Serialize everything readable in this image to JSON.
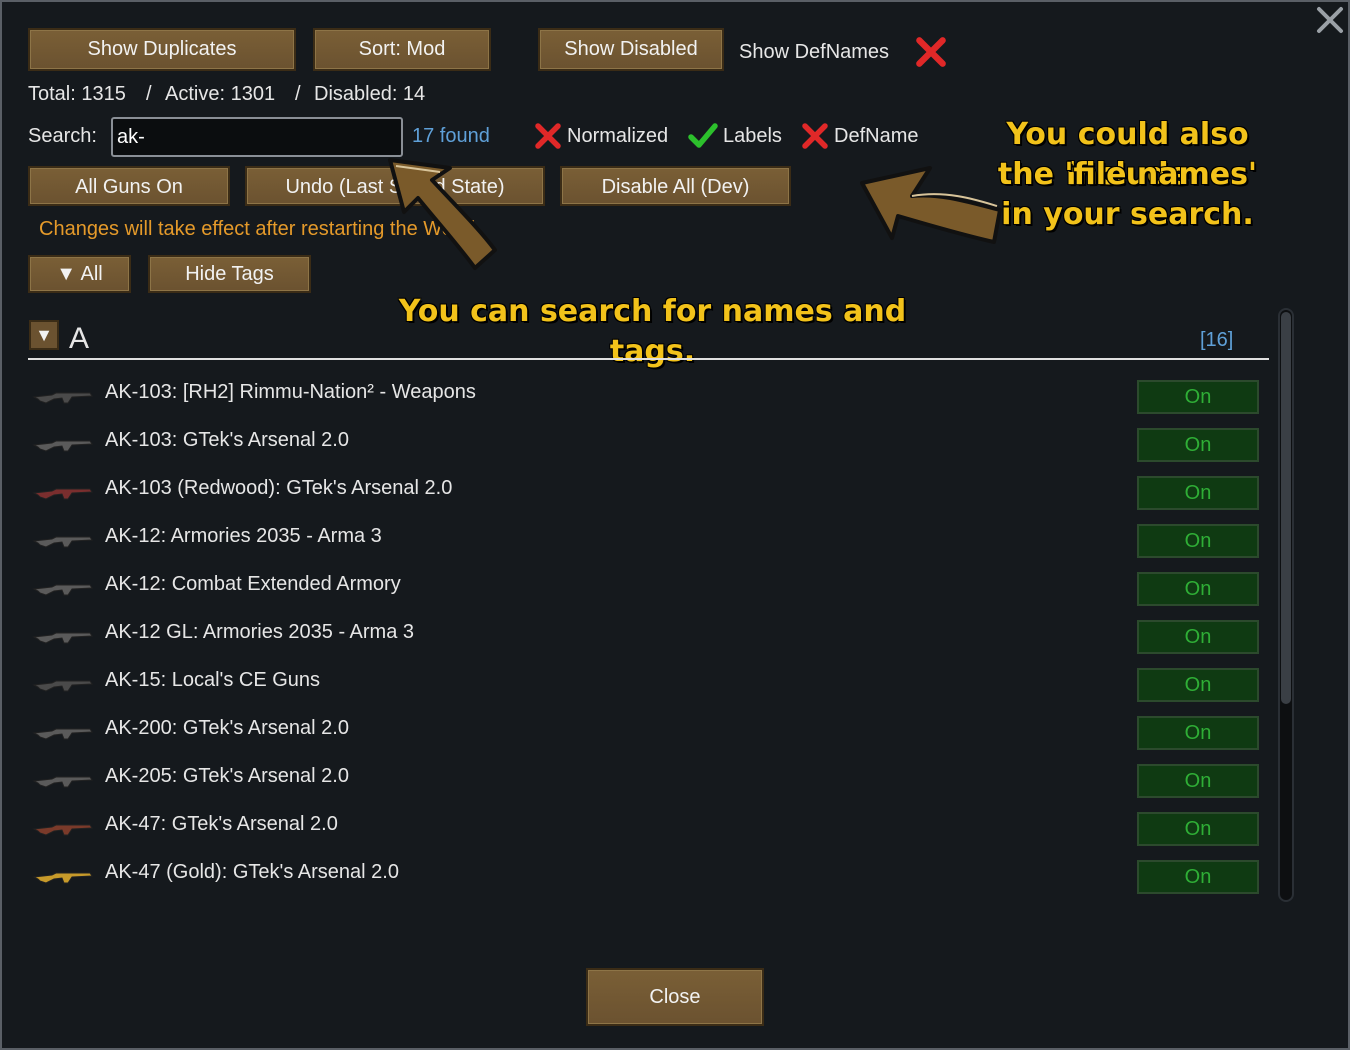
{
  "header": {
    "show_duplicates": "Show Duplicates",
    "sort": "Sort: Mod",
    "show_disabled": "Show Disabled",
    "show_defnames": "Show DefNames"
  },
  "stats": {
    "total": "Total: 1315",
    "sep1": "/",
    "active": "Active: 1301",
    "sep2": "/",
    "disabled": "Disabled: 14"
  },
  "search": {
    "label": "Search:",
    "value": "ak-",
    "found": "17 found",
    "normalized": "Normalized",
    "labels": "Labels",
    "defname": "DefName"
  },
  "actions": {
    "all_guns_on": "All Guns On",
    "undo": "Undo (Last Saved State)",
    "disable_all": "Disable All (Dev)"
  },
  "warning": "Changes will take effect after restarting the World.",
  "filters": {
    "all": "▼ All",
    "hide_tags": "Hide Tags"
  },
  "section": {
    "toggle": "▼",
    "letter": "A",
    "count": "[16]"
  },
  "annotations": {
    "search_hint": "You can search for names and tags.",
    "file_hint_1": "You could also include",
    "file_hint_2": "the 'file names'",
    "file_hint_3": "in your search."
  },
  "items": [
    {
      "name": "AK-103: [RH2] Rimmu-Nation² - Weapons",
      "state": "On",
      "icon_color": "#4a4a4a"
    },
    {
      "name": "AK-103: GTek's Arsenal 2.0",
      "state": "On",
      "icon_color": "#5a5a5a"
    },
    {
      "name": "AK-103 (Redwood): GTek's Arsenal 2.0",
      "state": "On",
      "icon_color": "#7a2e2e"
    },
    {
      "name": "AK-12: Armories 2035 - Arma 3",
      "state": "On",
      "icon_color": "#5a5a5a"
    },
    {
      "name": "AK-12: Combat Extended Armory",
      "state": "On",
      "icon_color": "#5a5a5a"
    },
    {
      "name": "AK-12 GL: Armories 2035 - Arma 3",
      "state": "On",
      "icon_color": "#5a5a5a"
    },
    {
      "name": "AK-15: Local's CE Guns",
      "state": "On",
      "icon_color": "#4a4a4a"
    },
    {
      "name": "AK-200: GTek's Arsenal 2.0",
      "state": "On",
      "icon_color": "#5a5a5a"
    },
    {
      "name": "AK-205: GTek's Arsenal 2.0",
      "state": "On",
      "icon_color": "#5a5a5a"
    },
    {
      "name": "AK-47: GTek's Arsenal 2.0",
      "state": "On",
      "icon_color": "#7a3a2a"
    },
    {
      "name": "AK-47 (Gold): GTek's Arsenal 2.0",
      "state": "On",
      "icon_color": "#c79a2a"
    }
  ],
  "footer": {
    "close": "Close"
  },
  "colors": {
    "accent_text": "#f2c21a",
    "on_text": "#2fae36",
    "found_text": "#5fa0d8",
    "warning_text": "#e59a2a"
  }
}
